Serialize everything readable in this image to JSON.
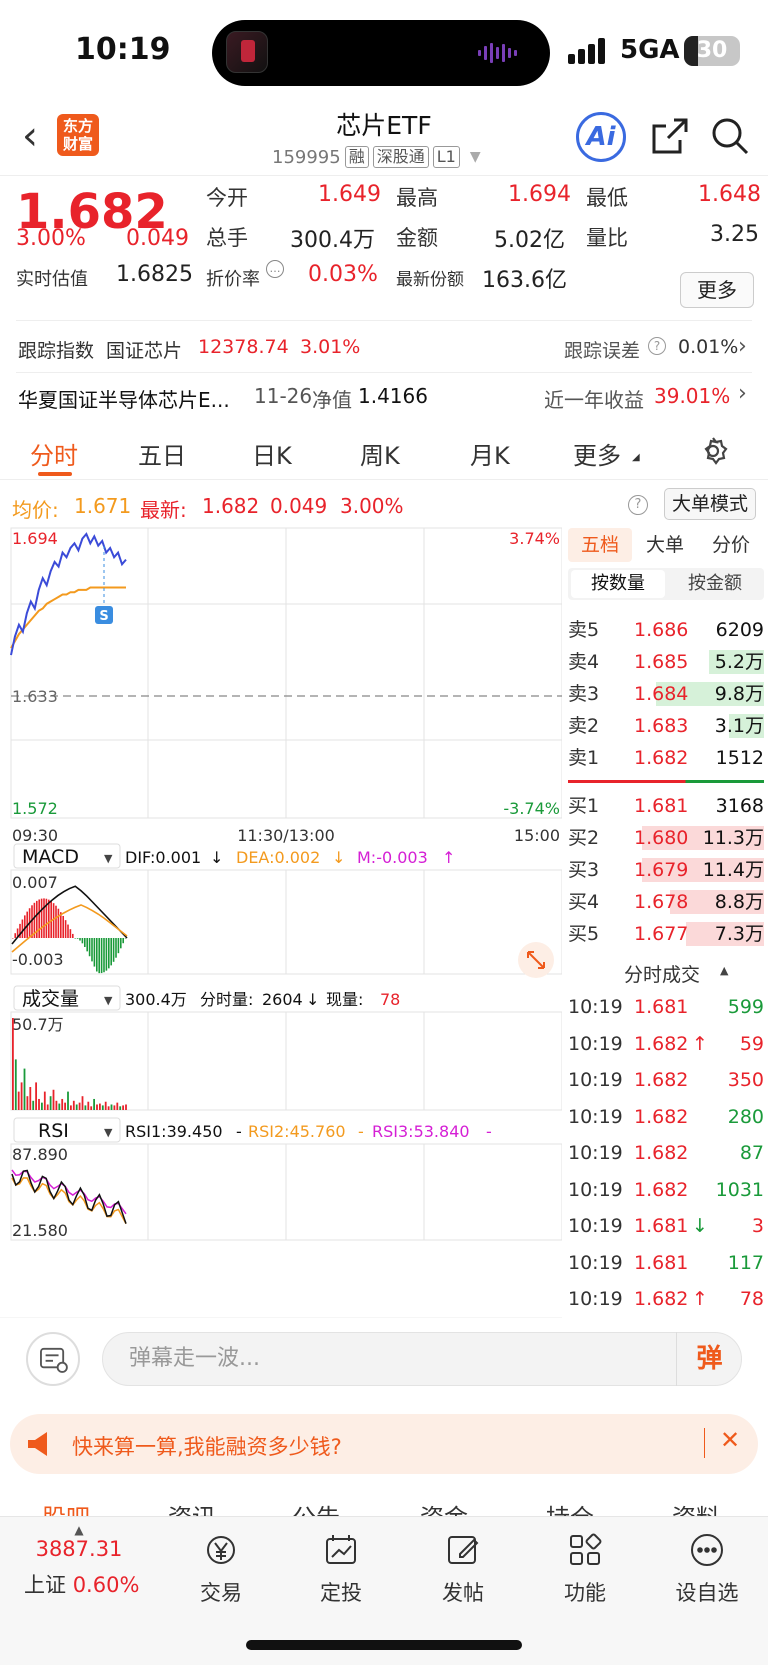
{
  "status": {
    "time": "10:19",
    "network": "5GA",
    "battery": "30"
  },
  "nav": {
    "title": "芯片ETF",
    "code": "159995",
    "tags": [
      "融",
      "深股通",
      "L1"
    ],
    "logo_line1": "东方",
    "logo_line2": "财富",
    "ai_label": "Ai"
  },
  "quote": {
    "price": "1.682",
    "change_pct": "3.00%",
    "change": "0.049",
    "est_label": "实时估值",
    "est_value": "1.6825",
    "open_label": "今开",
    "open": "1.649",
    "high_label": "最高",
    "high": "1.694",
    "low_label": "最低",
    "low": "1.648",
    "volume_label": "总手",
    "volume": "300.4万",
    "amount_label": "金额",
    "amount": "5.02亿",
    "ratio_label": "量比",
    "ratio": "3.25",
    "discount_label": "折价率",
    "discount": "0.03%",
    "shares_label": "最新份额",
    "shares": "163.6亿",
    "more_label": "更多"
  },
  "tracking": {
    "label": "跟踪指数",
    "index": "国证芯片",
    "value": "12378.74",
    "pct": "3.01%",
    "err_label": "跟踪误差",
    "err": "0.01%"
  },
  "fund": {
    "name": "华夏国证半导体芯片E...",
    "date": "11-26",
    "nav_label": "净值",
    "nav": "1.4166",
    "year_label": "近一年收益",
    "year": "39.01%"
  },
  "tabs": [
    "分时",
    "五日",
    "日K",
    "周K",
    "月K",
    "更多"
  ],
  "chart_header": {
    "avg_label": "均价:",
    "avg": "1.671",
    "last_label": "最新:",
    "last": "1.682",
    "chg": "0.049",
    "pct": "3.00%",
    "big_mode": "大单模式"
  },
  "chart_data": {
    "type": "line",
    "y_labels": {
      "top": "1.694",
      "mid": "1.633",
      "bottom": "1.572",
      "top_pct": "3.74%",
      "bottom_pct": "-3.74%"
    },
    "x_labels": [
      "09:30",
      "11:30/13:00",
      "15:00"
    ],
    "ylim": [
      1.572,
      1.694
    ],
    "price_series": [
      1.642,
      1.65,
      1.655,
      1.652,
      1.66,
      1.665,
      1.662,
      1.67,
      1.675,
      1.672,
      1.678,
      1.682,
      1.68,
      1.686,
      1.684,
      1.688,
      1.69,
      1.687,
      1.692,
      1.694,
      1.69,
      1.693,
      1.689,
      1.691,
      1.686,
      1.688,
      1.684,
      1.686,
      1.681,
      1.683
    ],
    "avg_series": [
      1.645,
      1.648,
      1.651,
      1.653,
      1.655,
      1.657,
      1.659,
      1.661,
      1.662,
      1.664,
      1.665,
      1.666,
      1.667,
      1.668,
      1.668,
      1.669,
      1.669,
      1.67,
      1.67,
      1.67,
      1.671,
      1.671,
      1.671,
      1.671,
      1.671,
      1.671,
      1.671,
      1.671,
      1.671,
      1.671
    ],
    "macd": {
      "label": "MACD",
      "dif": "DIF:0.001",
      "dea": "DEA:0.002",
      "m": "M:-0.003",
      "top": "0.007",
      "bottom": "-0.003"
    },
    "vol": {
      "label": "成交量",
      "total": "300.4万",
      "period_label": "分时量:",
      "period": "2604",
      "now_label": "现量:",
      "now": "78",
      "top": "50.7万"
    },
    "rsi": {
      "label": "RSI",
      "rsi1": "RSI1:39.450",
      "rsi2": "RSI2:45.760",
      "rsi3": "RSI3:53.840",
      "top": "87.890",
      "bottom": "21.580"
    }
  },
  "orderbook": {
    "tabs": [
      "五档",
      "大单",
      "分价"
    ],
    "subtabs": [
      "按数量",
      "按金额"
    ],
    "asks": [
      {
        "label": "卖5",
        "price": "1.686",
        "qty": "6209"
      },
      {
        "label": "卖4",
        "price": "1.685",
        "qty": "5.2万"
      },
      {
        "label": "卖3",
        "price": "1.684",
        "qty": "9.8万"
      },
      {
        "label": "卖2",
        "price": "1.683",
        "qty": "3.1万"
      },
      {
        "label": "卖1",
        "price": "1.682",
        "qty": "1512"
      }
    ],
    "bids": [
      {
        "label": "买1",
        "price": "1.681",
        "qty": "3168"
      },
      {
        "label": "买2",
        "price": "1.680",
        "qty": "11.3万"
      },
      {
        "label": "买3",
        "price": "1.679",
        "qty": "11.4万"
      },
      {
        "label": "买4",
        "price": "1.678",
        "qty": "8.8万"
      },
      {
        "label": "买5",
        "price": "1.677",
        "qty": "7.3万"
      }
    ],
    "trades_title": "分时成交",
    "trades": [
      {
        "time": "10:19",
        "price": "1.681",
        "arrow": "",
        "qty": "599",
        "side": "g"
      },
      {
        "time": "10:19",
        "price": "1.682",
        "arrow": "↑",
        "qty": "59",
        "side": "r"
      },
      {
        "time": "10:19",
        "price": "1.682",
        "arrow": "",
        "qty": "350",
        "side": "r"
      },
      {
        "time": "10:19",
        "price": "1.682",
        "arrow": "",
        "qty": "280",
        "side": "g"
      },
      {
        "time": "10:19",
        "price": "1.682",
        "arrow": "",
        "qty": "87",
        "side": "g"
      },
      {
        "time": "10:19",
        "price": "1.682",
        "arrow": "",
        "qty": "1031",
        "side": "g"
      },
      {
        "time": "10:19",
        "price": "1.681",
        "arrow": "↓",
        "qty": "3",
        "side": "r"
      },
      {
        "time": "10:19",
        "price": "1.681",
        "arrow": "",
        "qty": "117",
        "side": "g"
      },
      {
        "time": "10:19",
        "price": "1.682",
        "arrow": "↑",
        "qty": "78",
        "side": "r"
      }
    ]
  },
  "danmaku": {
    "placeholder": "弹幕走一波...",
    "btn": "弹"
  },
  "promo": {
    "text": "快来算一算,我能融资多少钱?"
  },
  "subtabs": [
    "股吧",
    "资讯",
    "公告",
    "资金",
    "持仓",
    "资料"
  ],
  "bottom": {
    "index_value": "3887.31",
    "index_name": "上证",
    "index_pct": "0.60%",
    "items": [
      "交易",
      "定投",
      "发帖",
      "功能",
      "设自选"
    ]
  },
  "colors": {
    "up": "#e8232b",
    "down": "#1a9a3a",
    "accent": "#ef5a1c",
    "avg": "#f39a1e"
  }
}
